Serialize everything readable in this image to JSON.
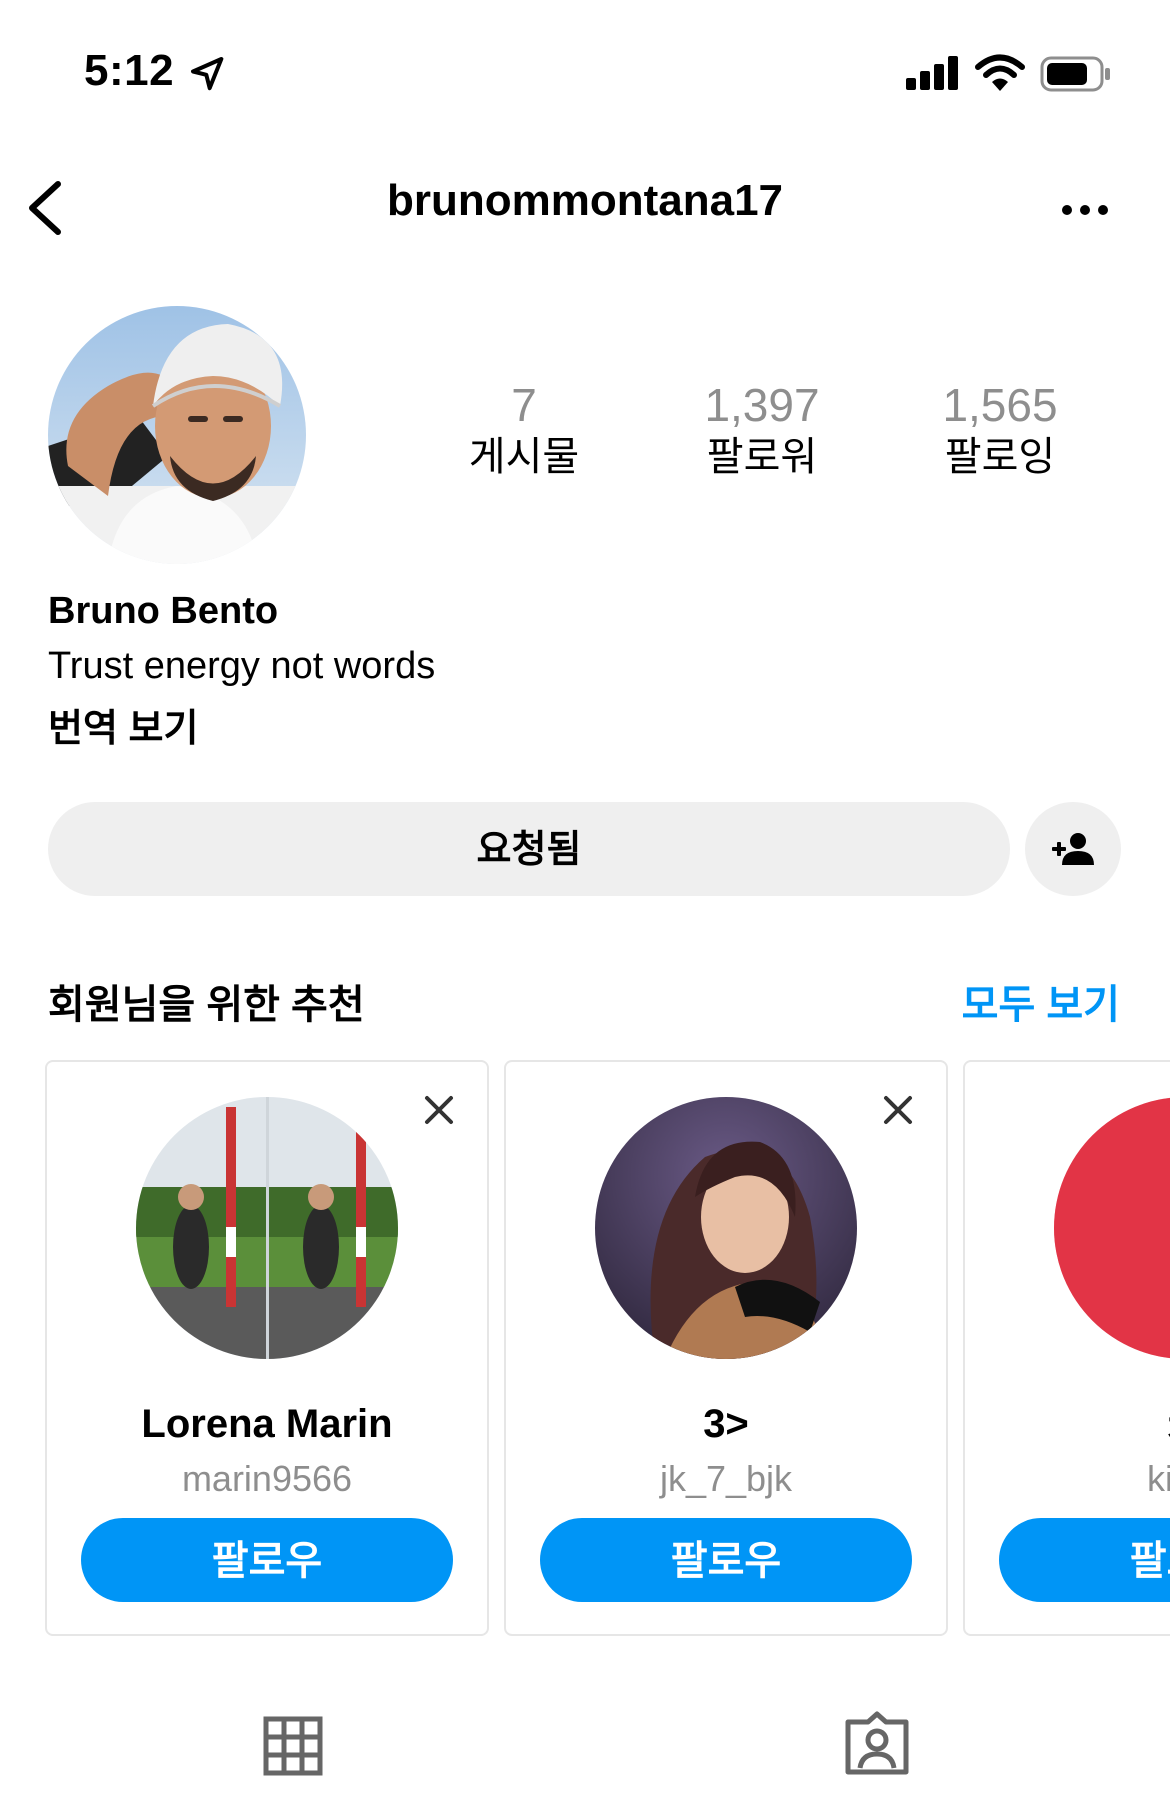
{
  "status_bar": {
    "time": "5:12",
    "icons": [
      "location-arrow-icon",
      "signal-icon",
      "wifi-icon",
      "battery-icon"
    ]
  },
  "header": {
    "username": "brunommontana17",
    "icons": [
      "back-arrow-icon",
      "more-options-icon"
    ]
  },
  "profile": {
    "stats": [
      {
        "value": "7",
        "label": "게시물"
      },
      {
        "value": "1,397",
        "label": "팔로워"
      },
      {
        "value": "1,565",
        "label": "팔로잉"
      }
    ],
    "name": "Bruno Bento",
    "bio": "Trust energy not words",
    "translate_label": "번역 보기",
    "requested_label": "요청됨"
  },
  "suggestions": {
    "title": "회원님을 위한 추천",
    "see_all_label": "모두 보기",
    "cards": [
      {
        "name": "Lorena Marin",
        "handle": "marin9566",
        "follow_label": "팔로우"
      },
      {
        "name": "3>",
        "handle": "jk_7_bjk",
        "follow_label": "팔로우"
      },
      {
        "name": "진",
        "handle": "kimg",
        "follow_label": "팔로우"
      }
    ]
  },
  "tabs": [
    "grid-icon",
    "tagged-icon"
  ],
  "colors": {
    "accent": "#0095f6",
    "muted": "#8e8e8e",
    "button_bg": "#efefef"
  }
}
